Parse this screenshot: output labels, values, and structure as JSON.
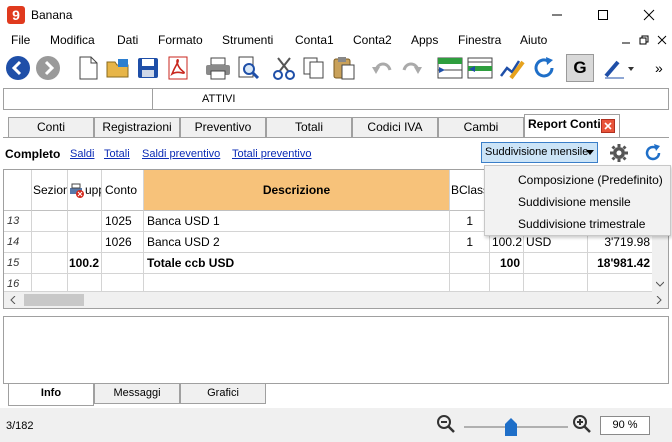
{
  "window": {
    "title": "Banana"
  },
  "menu": [
    "File",
    "Modifica",
    "Dati",
    "Formato",
    "Strumenti",
    "Conta1",
    "Conta2",
    "Apps",
    "Finestra",
    "Aiuto"
  ],
  "cellbar": {
    "value": "ATTIVI"
  },
  "tabs": [
    "Conti",
    "Registrazioni",
    "Preventivo",
    "Totali",
    "Codici IVA",
    "Cambi",
    "Report Conti"
  ],
  "views": {
    "current": "Completo",
    "links": [
      "Saldi",
      "Totali",
      "Saldi preventivo",
      "Totali preventivo"
    ]
  },
  "subdivision": {
    "selected": "Suddivisione mensile",
    "options": [
      "Composizione (Predefinito)",
      "Suddivisione mensile",
      "Suddivisione trimestrale"
    ]
  },
  "grid": {
    "headers": {
      "sezione": "Sezione",
      "gruppo": "upp",
      "conto": "Conto",
      "descrizione": "Descrizione",
      "bclass": "BClass"
    },
    "rows": [
      {
        "num": "13",
        "sezione": "",
        "gruppo": "",
        "conto": "1025",
        "descrizione": "Banca USD 1",
        "bclass": "1",
        "col6": "",
        "col7": "",
        "col8": ""
      },
      {
        "num": "14",
        "sezione": "",
        "gruppo": "",
        "conto": "1026",
        "descrizione": "Banca USD 2",
        "bclass": "1",
        "col6": "100.2",
        "col7": "USD",
        "col8": "3'719.98"
      },
      {
        "num": "15",
        "sezione": "",
        "gruppo": "100.2",
        "conto": "",
        "descrizione": "Totale ccb USD",
        "bclass": "",
        "col6": "100",
        "col7": "",
        "col8": "18'981.42"
      },
      {
        "num": "16",
        "sezione": "",
        "gruppo": "",
        "conto": "",
        "descrizione": "",
        "bclass": "",
        "col6": "",
        "col7": "",
        "col8": ""
      }
    ]
  },
  "bottom_tabs": [
    "Info",
    "Messaggi",
    "Grafici"
  ],
  "status": {
    "position": "3/182",
    "zoom": "90 %",
    "zoom_level": 0.45
  },
  "colors": {
    "header_highlight": "#f7c27a",
    "accent_blue": "#1f4fa8",
    "link": "#0b2bb5"
  }
}
